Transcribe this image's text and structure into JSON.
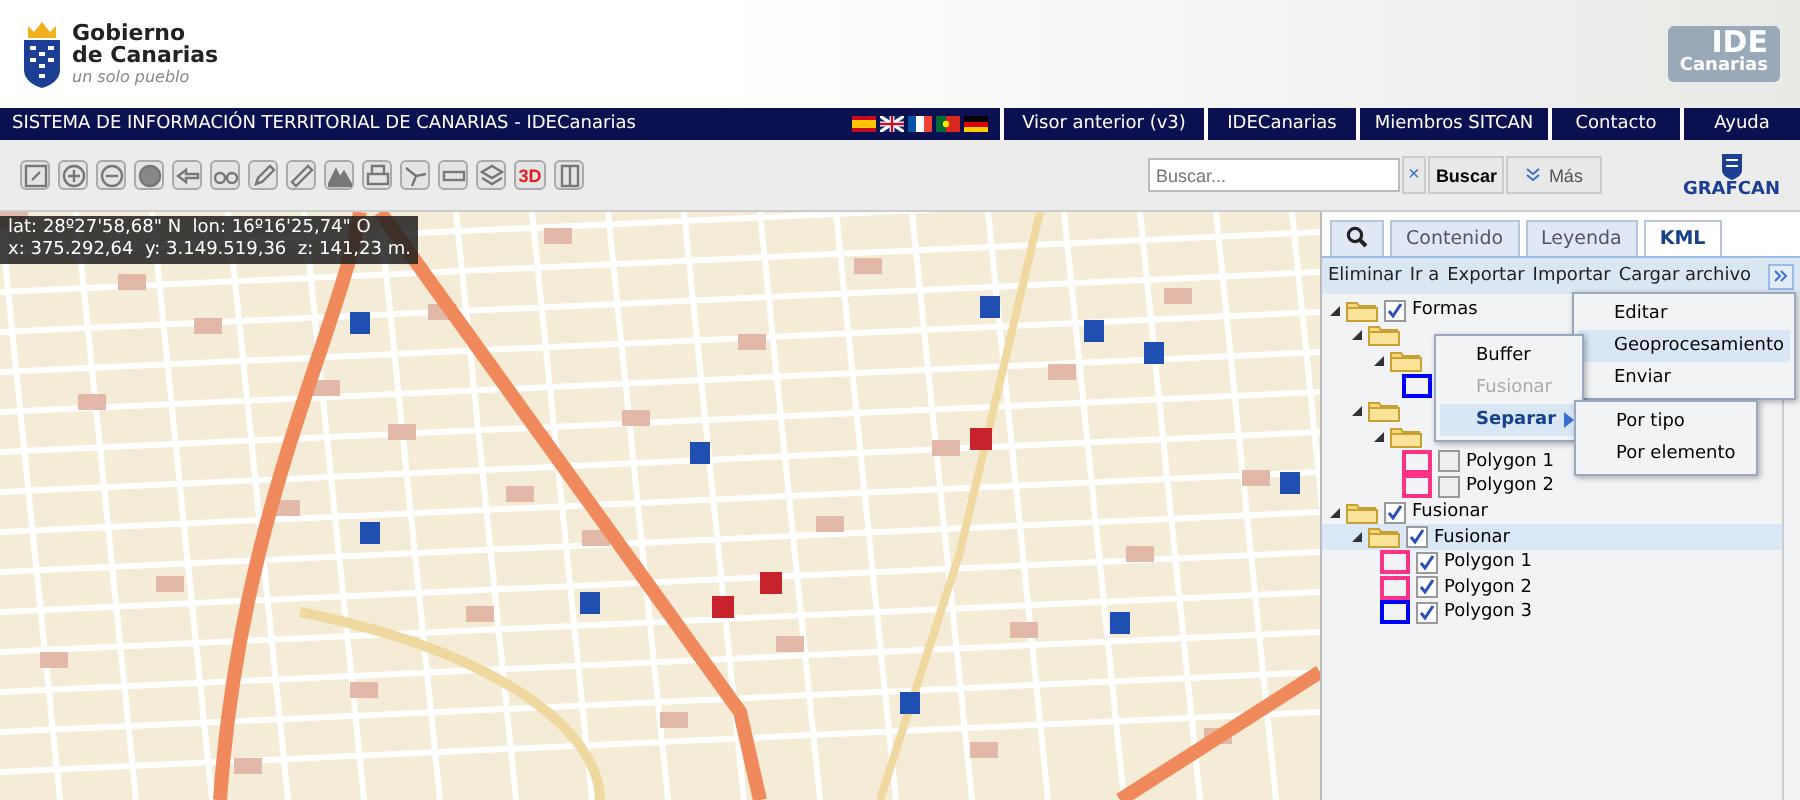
{
  "header": {
    "logo": {
      "line1": "Gobierno",
      "line2": "de Canarias",
      "tagline": "un solo pueblo"
    },
    "right_logo": {
      "title": "IDE",
      "subtitle": "Canarias"
    }
  },
  "nav": {
    "title": "SISTEMA DE INFORMACIÓN TERRITORIAL DE CANARIAS - IDECanarias",
    "links": [
      "Visor anterior (v3)",
      "IDECanarias",
      "Miembros SITCAN",
      "Contacto",
      "Ayuda"
    ]
  },
  "toolbar": {
    "label_3d": "3D",
    "search": {
      "placeholder": "Buscar...",
      "clear": "×",
      "button": "Buscar",
      "more": "Más"
    },
    "brand": "GRAFCAN"
  },
  "map": {
    "coords": [
      "lat: 28º27'58,68\" N  lon: 16º16'25,74\" O",
      "x: 375.292,64  y: 3.149.519,36  z: 141,23 m."
    ]
  },
  "panel": {
    "tabs": [
      {
        "kind": "icon",
        "selected": false
      },
      {
        "kind": "text",
        "label": "Contenido",
        "selected": false
      },
      {
        "kind": "text",
        "label": "Leyenda",
        "selected": false
      },
      {
        "kind": "text",
        "label": "KML",
        "selected": true
      }
    ],
    "actions": [
      "Eliminar",
      "Ir a",
      "Exportar",
      "Importar",
      "Cargar archivo"
    ],
    "tree": [
      {
        "label": "Formas",
        "checked": true,
        "selected": false,
        "children": [
          {
            "selected": false,
            "children": [
              {
                "selected": false,
                "children": [
                  {
                    "selected": false,
                    "color": "#0000ff"
                  }
                ]
              }
            ]
          },
          {
            "selected": false,
            "children": [
              {
                "selected": false,
                "children": [
                  {
                    "label": "Polygon 1",
                    "checked": false,
                    "selected": false,
                    "color": "#ff3385"
                  },
                  {
                    "label": "Polygon 2",
                    "checked": false,
                    "selected": false,
                    "color": "#ff3385"
                  }
                ]
              }
            ]
          }
        ]
      },
      {
        "label": "Fusionar",
        "checked": true,
        "selected": false,
        "children": [
          {
            "label": "Fusionar",
            "checked": true,
            "selected": true,
            "children": [
              {
                "label": "Polygon 1",
                "checked": true,
                "selected": false,
                "color": "#ff3385"
              },
              {
                "label": "Polygon 2",
                "checked": true,
                "selected": false,
                "color": "#ff3385"
              },
              {
                "label": "Polygon 3",
                "checked": true,
                "selected": false,
                "color": "#0000ff"
              }
            ]
          }
        ]
      }
    ]
  },
  "menus": {
    "main": [
      {
        "label": "Editar",
        "selected": false,
        "submenu": false,
        "disabled": false
      },
      {
        "label": "Geoprocesamiento",
        "selected": true,
        "submenu": true,
        "disabled": false
      },
      {
        "label": "Enviar",
        "selected": false,
        "submenu": false,
        "disabled": false
      }
    ],
    "geoprocess": [
      {
        "label": "Buffer",
        "selected": false,
        "submenu": false,
        "disabled": false
      },
      {
        "label": "Fusionar",
        "selected": false,
        "submenu": false,
        "disabled": true
      },
      {
        "label": "Separar",
        "selected": true,
        "submenu": true,
        "disabled": false
      }
    ],
    "separar": [
      {
        "label": "Por tipo",
        "selected": false,
        "submenu": false,
        "disabled": false
      },
      {
        "label": "Por elemento",
        "selected": false,
        "submenu": false,
        "disabled": false
      }
    ]
  }
}
